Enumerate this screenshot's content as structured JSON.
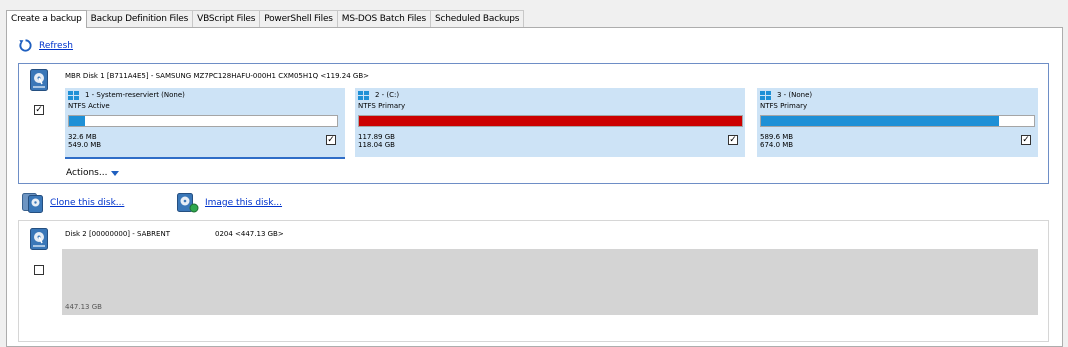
{
  "tabs": [
    {
      "label": "Create a backup",
      "active": true
    },
    {
      "label": "Backup Definition Files",
      "active": false
    },
    {
      "label": "VBScript Files",
      "active": false
    },
    {
      "label": "PowerShell Files",
      "active": false
    },
    {
      "label": "MS-DOS Batch Files",
      "active": false
    },
    {
      "label": "Scheduled Backups",
      "active": false
    }
  ],
  "refresh": {
    "label": "Refresh",
    "icon": "refresh-icon"
  },
  "disk1": {
    "title": "MBR Disk 1 [B711A4E5] - SAMSUNG MZ7PC128HAFU-000H1 CXM05H1Q  <119.24 GB>",
    "checked": true,
    "partitions": [
      {
        "title": "1 - System-reserviert (None)",
        "type": "NTFS Active",
        "used": "32.6 MB",
        "total": "549.0 MB",
        "fill": 0.06,
        "color": "#1e90d6",
        "checked": true
      },
      {
        "title": "2 - (C:)",
        "type": "NTFS Primary",
        "used": "117.89 GB",
        "total": "118.04 GB",
        "fill": 1.0,
        "color": "#cc0000",
        "checked": true
      },
      {
        "title": "3 - (None)",
        "type": "NTFS Primary",
        "used": "589.6 MB",
        "total": "674.0 MB",
        "fill": 0.87,
        "color": "#1e90d6",
        "checked": true
      }
    ],
    "actions_label": "Actions..."
  },
  "links": {
    "clone": "Clone this disk...",
    "image": "Image this disk..."
  },
  "disk2": {
    "title": "Disk 2 [00000000] - SABRENT",
    "info": "0204  <447.13 GB>",
    "checked": false,
    "unallocated_size": "447.13 GB"
  },
  "colors": {
    "accent": "#0033cc",
    "partition_bg": "#cde3f6",
    "used_fill_blue": "#1e90d6",
    "used_fill_red": "#cc0000"
  }
}
